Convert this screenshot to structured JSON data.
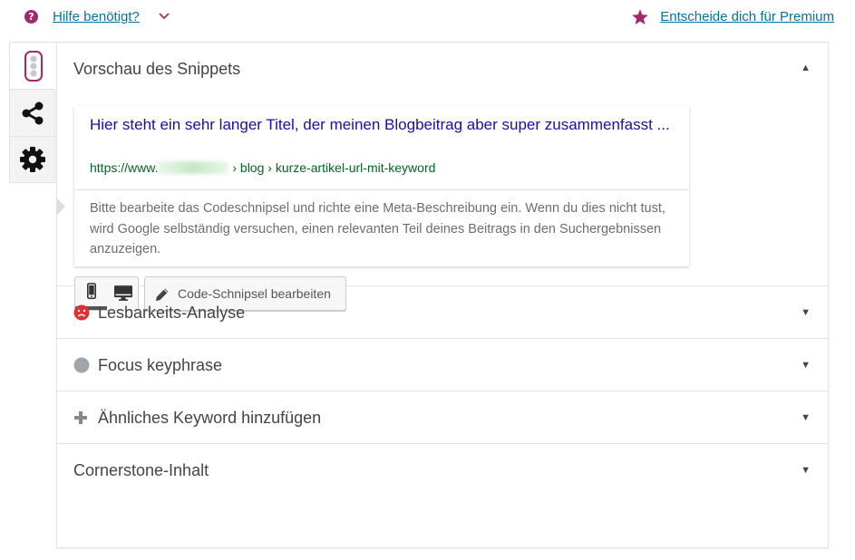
{
  "header": {
    "help_label": "Hilfe benötigt?",
    "premium_label": "Entscheide dich für Premium",
    "accent_color": "#a4286a",
    "link_color": "#0073aa"
  },
  "tabs": [
    {
      "icon": "traffic-light-icon",
      "active": true
    },
    {
      "icon": "share-icon",
      "active": false
    },
    {
      "icon": "gear-icon",
      "active": false
    }
  ],
  "snippet_preview": {
    "heading": "Vorschau des Snippets",
    "title": "Hier steht ein sehr langer Titel, der meinen Blogbeitrag aber super zusammenfasst ...",
    "url_prefix": "https://www.",
    "url_path": "› blog › kurze-artikel-url-mit-keyword",
    "description": "Bitte bearbeite das Codeschnipsel und richte eine Meta-Beschreibung ein. Wenn du dies nicht tust, wird Google selbständig versuchen, einen relevanten Teil deines Beitrags in den Suchergebnissen anzuzeigen.",
    "edit_button_label": "Code-Schnipsel bearbeiten",
    "active_mode": "mobile",
    "title_color": "#1a0dab",
    "url_color": "#006621"
  },
  "sections": {
    "readability": {
      "label": "Lesbarkeits-Analyse",
      "icon": "sad-face-icon",
      "status_color": "#dc3232"
    },
    "focus": {
      "label": "Focus keyphrase",
      "icon": "grey-dot-icon",
      "status_color": "#a0a5aa"
    },
    "related": {
      "label": "Ähnliches Keyword hinzufügen",
      "icon": "plus-icon"
    },
    "cornerstone": {
      "label": "Cornerstone-Inhalt"
    }
  }
}
